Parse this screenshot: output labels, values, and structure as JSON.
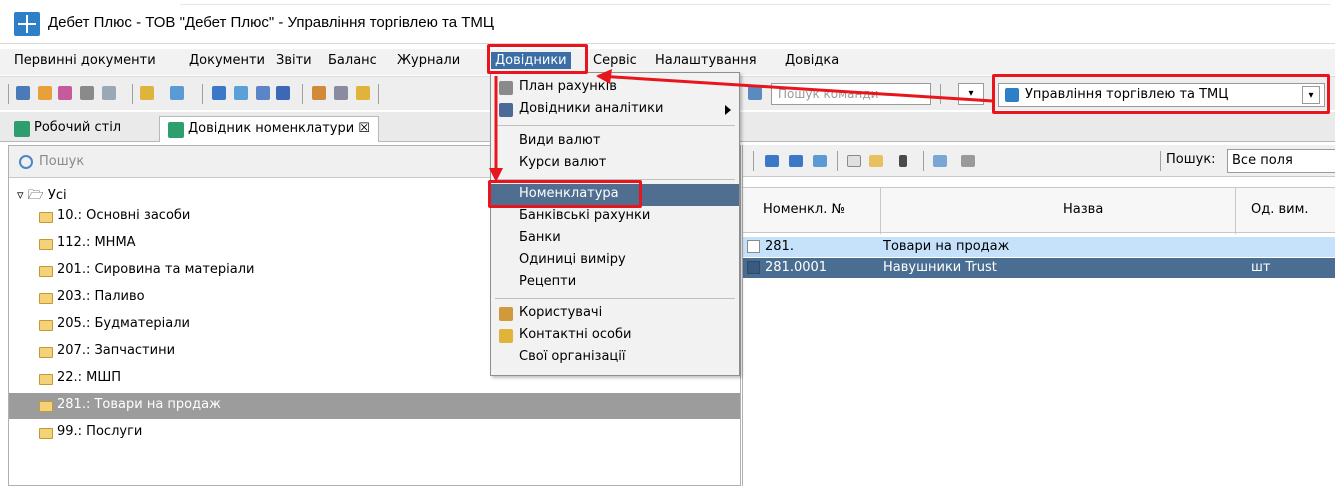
{
  "window": {
    "title": "Дебет Плюс - ТОВ \"Дебет Плюс\" - Управління торгівлею та ТМЦ"
  },
  "menubar": {
    "items": [
      "Первинні документи",
      "Документи",
      "Звіти",
      "Баланс",
      "Журнали",
      "Довідники",
      "Сервіс",
      "Налаштування",
      "Довідка"
    ],
    "active": "Довідники"
  },
  "toolbar": {
    "command_search_placeholder": "Пошук команди",
    "module": "Управління торгівлею та ТМЦ"
  },
  "tabs": [
    {
      "label": "Робочий стіл",
      "icon": "desktop-icon"
    },
    {
      "label": "Довідник номенклатури ☒",
      "icon": "catalog-icon",
      "active": true
    }
  ],
  "tree": {
    "search_placeholder": "Пошук",
    "root": "▿ 🗁 Усі",
    "items": [
      "10.: Основні засоби",
      "112.: МНМА",
      "201.: Сировина та матеріали",
      "203.: Паливо",
      "205.: Будматеріали",
      "207.: Запчастини",
      "22.: МШП",
      "281.: Товари на продаж",
      "99.: Послуги"
    ],
    "selected": "281.: Товари на продаж"
  },
  "grid": {
    "search_label": "Пошук:",
    "search_field": "Все поля",
    "columns": [
      "Номенкл. №",
      "Назва",
      "Од. вим."
    ],
    "rows": [
      {
        "num": "281.",
        "name": "Товари на продаж",
        "unit": ""
      },
      {
        "num": "281.0001",
        "name": "Навушники Trust",
        "unit": "шт"
      }
    ]
  },
  "dropdown": {
    "items": [
      "План рахунків",
      "Довідники аналітики",
      "Види валют",
      "Курси валют",
      "Номенклатура",
      "Банківські рахунки",
      "Банки",
      "Одиниці виміру",
      "Рецепти",
      "Користувачі",
      "Контактні особи",
      "Свої організації"
    ],
    "highlighted": "Номенклатура"
  },
  "colors": {
    "accent": "#3a6ea5",
    "annotation": "#e8161c",
    "selected_row": "#4a6e92"
  }
}
